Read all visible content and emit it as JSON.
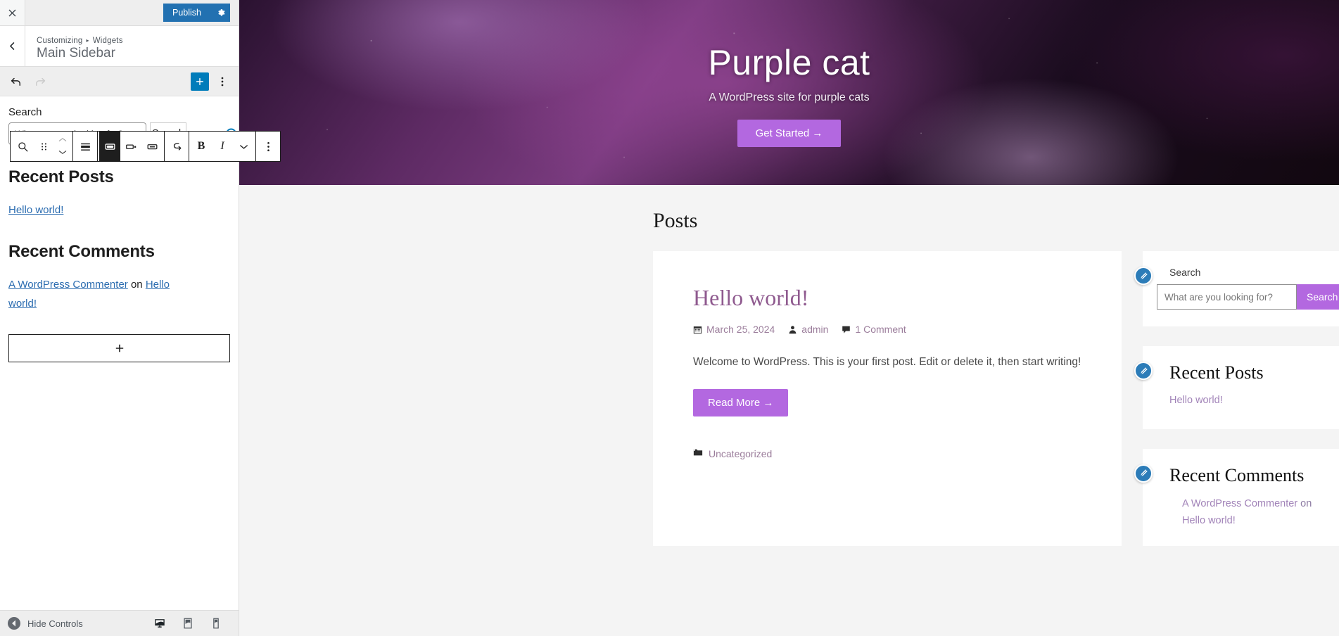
{
  "customizer": {
    "close_label": "×",
    "publish_label": "Publish",
    "gear_icon": "gear-icon",
    "back_icon": "chevron-left-icon",
    "breadcrumb_root": "Customizing",
    "breadcrumb_sep": "▸",
    "breadcrumb_current": "Widgets",
    "section_title": "Main Sidebar",
    "undo_icon": "undo-icon",
    "redo_icon": "redo-icon",
    "add_block_icon": "plus-icon",
    "options_icon": "kebab-menu-icon",
    "accent_blue": "#2271b1",
    "add_block_blue": "#007cba",
    "block_toolbar": {
      "block_type_icon": "search-block-icon",
      "drag_icon": "drag-handle-icon",
      "move_up_icon": "chevron-up-icon",
      "move_down_icon": "chevron-down-icon",
      "align_icon": "align-icon",
      "button_outside_icon": "button-outside-icon",
      "button_inside_icon": "button-inside-icon",
      "button_only_icon": "button-only-icon",
      "link_icon": "toggle-search-label-icon",
      "bold_label": "B",
      "italic_label": "I",
      "more_rich_text_icon": "chevron-down-icon",
      "more_options_icon": "kebab-menu-icon",
      "active_button": "button-outside-icon"
    },
    "search_block": {
      "label": "Search",
      "placeholder": "What are you looking for?",
      "value": "",
      "button_label": "Search",
      "resize_handle": "resize-handle"
    },
    "recent_posts": {
      "heading": "Recent Posts",
      "items": [
        {
          "label": "Hello world!"
        }
      ]
    },
    "recent_comments": {
      "heading": "Recent Comments",
      "author": "A WordPress Commenter",
      "connector": " on ",
      "post": "Hello world!"
    },
    "appender_icon": "plus-icon",
    "footer": {
      "hide_controls_label": "Hide Controls",
      "collapse_icon": "collapse-icon",
      "devices": [
        {
          "name": "desktop",
          "icon": "desktop-icon",
          "active": true
        },
        {
          "name": "tablet",
          "icon": "tablet-icon",
          "active": false
        },
        {
          "name": "mobile",
          "icon": "mobile-icon",
          "active": false
        }
      ]
    }
  },
  "preview": {
    "hero": {
      "site_title": "Purple cat",
      "tagline": "A WordPress site for purple cats",
      "cta_label": "Get Started  →",
      "accent_purple": "#b368e0"
    },
    "page_title": "Posts",
    "post": {
      "title": "Hello world!",
      "date_icon": "calendar-icon",
      "date": "March 25, 2024",
      "author_icon": "user-icon",
      "author": "admin",
      "comment_icon": "comment-icon",
      "comments": "1 Comment",
      "excerpt": "Welcome to WordPress. This is your first post. Edit or delete it, then start writing!",
      "read_more_label": "Read More  →",
      "category_icon": "folder-icon",
      "category": "Uncategorized"
    },
    "sidebar": {
      "edit_icon": "edit-pencil-icon",
      "search": {
        "label": "Search",
        "placeholder": "What are you looking for?",
        "value": "",
        "button_label": "Search"
      },
      "recent_posts": {
        "heading": "Recent Posts",
        "items": [
          {
            "label": "Hello world!"
          }
        ]
      },
      "recent_comments": {
        "heading": "Recent Comments",
        "author": "A WordPress Commenter",
        "connector": " on ",
        "post": "Hello world!"
      }
    }
  }
}
